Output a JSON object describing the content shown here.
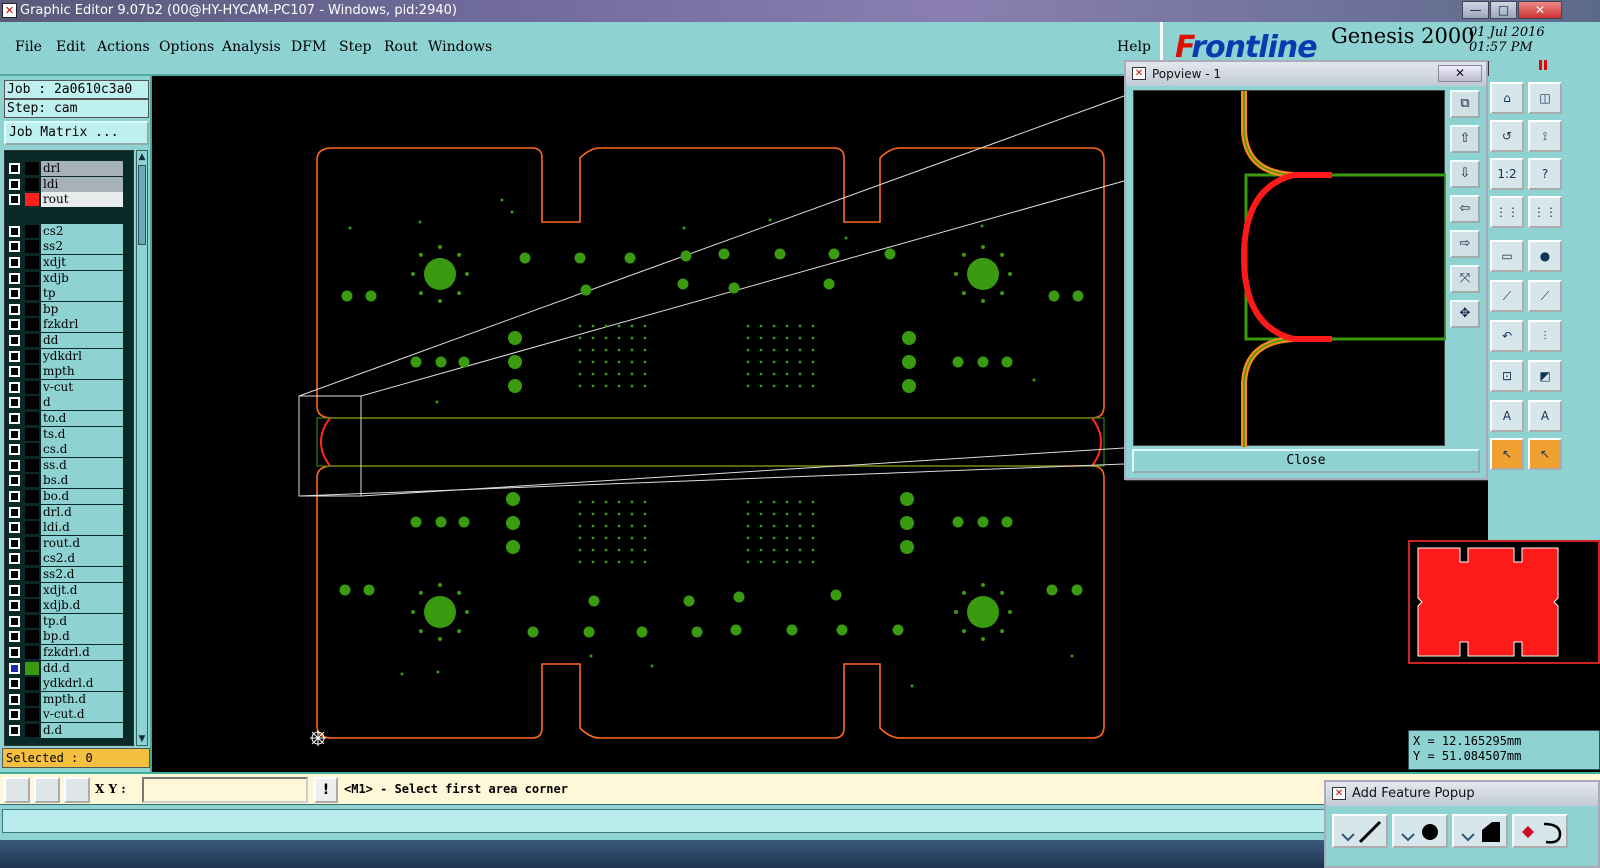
{
  "window": {
    "title": "Graphic Editor 9.07b2 (00@HY-HYCAM-PC107 - Windows, pid:2940)",
    "icon": "app-icon",
    "controls": [
      "minimize",
      "maximize",
      "close"
    ]
  },
  "menu": {
    "items": [
      "File",
      "Edit",
      "Actions",
      "Options",
      "Analysis",
      "DFM",
      "Step",
      "Rout",
      "Windows"
    ],
    "help": "Help"
  },
  "brand": {
    "logo_f": "F",
    "logo_rest": "rontline",
    "product": "Genesis 2000",
    "date": "01 Jul 2016",
    "time": "01:57 PM"
  },
  "job": {
    "job_line": "Job : 2a0610c3a0",
    "step_line": "Step: cam",
    "matrix_button": "Job Matrix ..."
  },
  "layers": [
    {
      "name": "drl",
      "color": "#a7b2b8",
      "swatch": "#000000"
    },
    {
      "name": "ldi",
      "color": "#a7b2b8",
      "swatch": "#000000"
    },
    {
      "name": "rout",
      "color": "#e8ecec",
      "swatch": "#ff2020"
    },
    {
      "name": "cs2",
      "color": "#8fd2d2",
      "swatch": "#000000"
    },
    {
      "name": "ss2",
      "color": "#8fd2d2",
      "swatch": "#000000"
    },
    {
      "name": "xdjt",
      "color": "#8fd2d2",
      "swatch": "#000000"
    },
    {
      "name": "xdjb",
      "color": "#8fd2d2",
      "swatch": "#000000"
    },
    {
      "name": "tp",
      "color": "#8fd2d2",
      "swatch": "#000000"
    },
    {
      "name": "bp",
      "color": "#8fd2d2",
      "swatch": "#000000"
    },
    {
      "name": "fzkdrl",
      "color": "#8fd2d2",
      "swatch": "#000000"
    },
    {
      "name": "dd",
      "color": "#8fd2d2",
      "swatch": "#000000"
    },
    {
      "name": "ydkdrl",
      "color": "#8fd2d2",
      "swatch": "#000000"
    },
    {
      "name": "mpth",
      "color": "#8fd2d2",
      "swatch": "#000000"
    },
    {
      "name": "v-cut",
      "color": "#8fd2d2",
      "swatch": "#000000"
    },
    {
      "name": "d",
      "color": "#8fd2d2",
      "swatch": "#000000"
    },
    {
      "name": "to.d",
      "color": "#8fd2d2",
      "swatch": "#000000"
    },
    {
      "name": "ts.d",
      "color": "#8fd2d2",
      "swatch": "#000000"
    },
    {
      "name": "cs.d",
      "color": "#8fd2d2",
      "swatch": "#000000"
    },
    {
      "name": "ss.d",
      "color": "#8fd2d2",
      "swatch": "#000000"
    },
    {
      "name": "bs.d",
      "color": "#8fd2d2",
      "swatch": "#000000"
    },
    {
      "name": "bo.d",
      "color": "#8fd2d2",
      "swatch": "#000000"
    },
    {
      "name": "drl.d",
      "color": "#8fd2d2",
      "swatch": "#000000"
    },
    {
      "name": "ldi.d",
      "color": "#8fd2d2",
      "swatch": "#000000"
    },
    {
      "name": "rout.d",
      "color": "#8fd2d2",
      "swatch": "#000000"
    },
    {
      "name": "cs2.d",
      "color": "#8fd2d2",
      "swatch": "#000000"
    },
    {
      "name": "ss2.d",
      "color": "#8fd2d2",
      "swatch": "#000000"
    },
    {
      "name": "xdjt.d",
      "color": "#8fd2d2",
      "swatch": "#000000"
    },
    {
      "name": "xdjb.d",
      "color": "#8fd2d2",
      "swatch": "#000000"
    },
    {
      "name": "tp.d",
      "color": "#8fd2d2",
      "swatch": "#000000"
    },
    {
      "name": "bp.d",
      "color": "#8fd2d2",
      "swatch": "#000000"
    },
    {
      "name": "fzkdrl.d",
      "color": "#8fd2d2",
      "swatch": "#000000"
    },
    {
      "name": "dd.d",
      "color": "#8fd2d2",
      "swatch": "#3a9a10"
    },
    {
      "name": "ydkdrl.d",
      "color": "#8fd2d2",
      "swatch": "#000000"
    },
    {
      "name": "mpth.d",
      "color": "#8fd2d2",
      "swatch": "#000000"
    },
    {
      "name": "v-cut.d",
      "color": "#8fd2d2",
      "swatch": "#000000"
    },
    {
      "name": "d.d",
      "color": "#8fd2d2",
      "swatch": "#000000"
    }
  ],
  "selected": "Selected : 0",
  "popview": {
    "title": "Popview - 1",
    "close_label": "Close"
  },
  "coords": {
    "x": "X = 12.165295mm",
    "y": "Y = 51.084507mm"
  },
  "command": {
    "xy_label": "X Y :",
    "xy_value": "",
    "prompt": "<M1> - Select first area corner"
  },
  "add_feature": {
    "title": "Add Feature Popup"
  },
  "colors": {
    "panel": "#8fd2d2",
    "rout": "#ff6a1a",
    "pads": "#3a9a10",
    "preview_fill": "#ff1a1a"
  }
}
